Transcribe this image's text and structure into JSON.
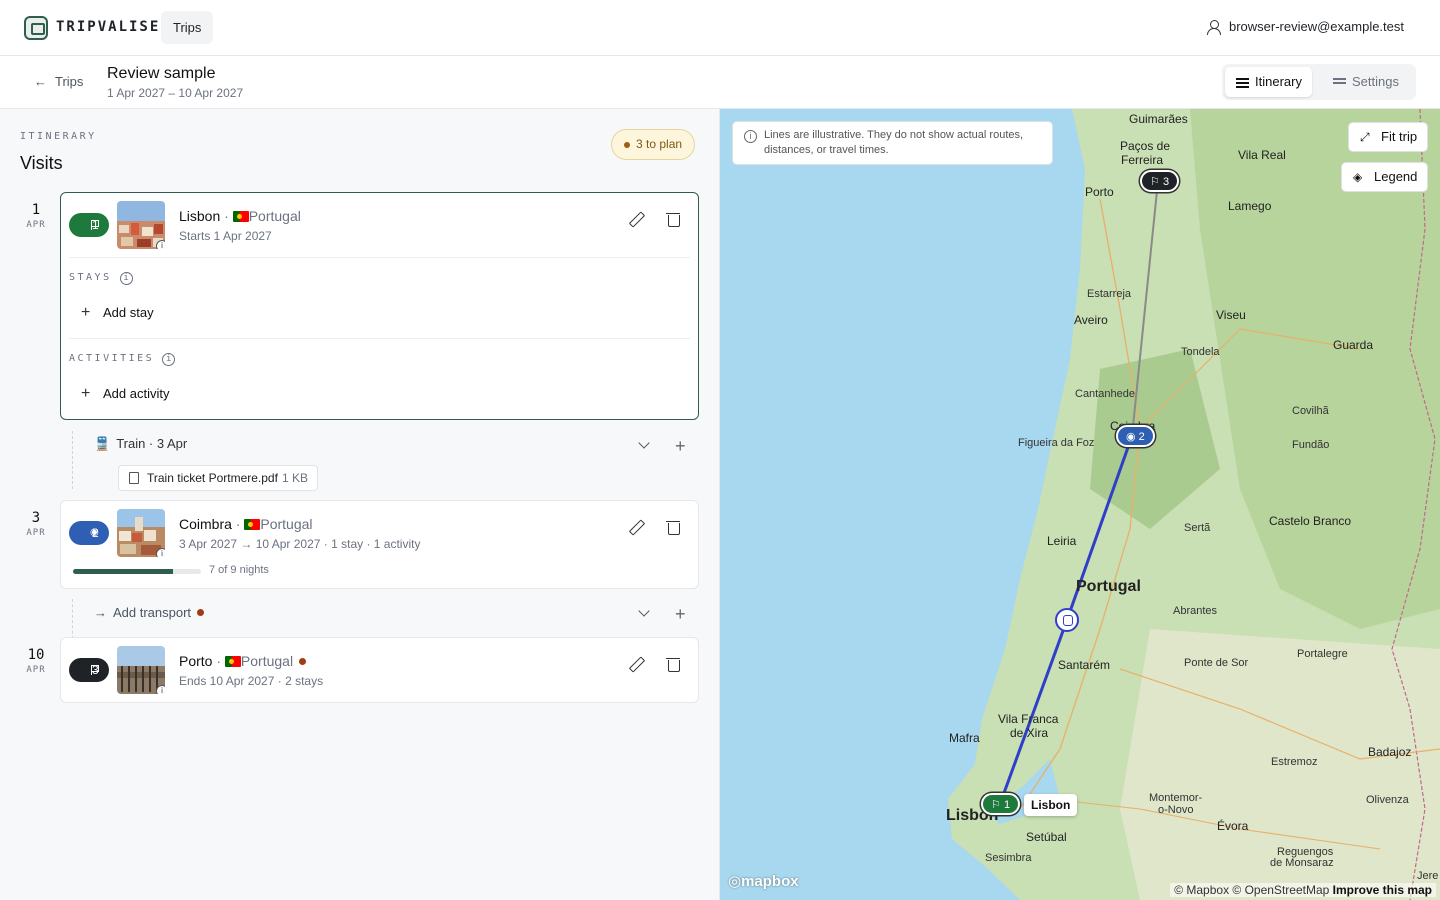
{
  "app": {
    "brand": "TRIPVALISE",
    "nav_tab": "Trips",
    "user_email": "browser-review@example.test"
  },
  "header": {
    "back_label": "Trips",
    "trip_title": "Review sample",
    "trip_dates": "1 Apr 2027 – 10 Apr 2027",
    "tabs": [
      {
        "label": "Itinerary",
        "active": true
      },
      {
        "label": "Settings",
        "active": false
      }
    ]
  },
  "itinerary": {
    "section_label": "ITINERARY",
    "title": "Visits",
    "to_plan": "3 to plan",
    "visits": [
      {
        "day": "1",
        "month": "APR",
        "badge": "1",
        "badge_color": "#1e7a3c",
        "city": "Lisbon",
        "country": "Portugal",
        "subtitle": "Starts 1 Apr 2027",
        "stays_label": "STAYS",
        "add_stay": "Add stay",
        "activities_label": "ACTIVITIES",
        "add_activity": "Add activity"
      },
      {
        "day": "3",
        "month": "APR",
        "badge": "2",
        "badge_color": "#2f5fb3",
        "city": "Coimbra",
        "country": "Portugal",
        "subtitle": "3 Apr 2027 → 10 Apr 2027 · 1 stay · 1 activity",
        "nights_label": "7 of 9 nights",
        "nights_progress": 0.78
      },
      {
        "day": "10",
        "month": "APR",
        "badge": "3",
        "badge_color": "#1f2328",
        "city": "Porto",
        "country": "Portugal",
        "subtitle": "Ends 10 Apr 2027 · 2 stays"
      }
    ],
    "transports": [
      {
        "label": "Train · 3 Apr",
        "file_name": "Train ticket Portmere.pdf",
        "file_size": "1 KB"
      },
      {
        "label": "Add transport"
      }
    ]
  },
  "map": {
    "note": "Lines are illustrative. They do not show actual routes, distances, or travel times.",
    "fit_trip": "Fit trip",
    "legend": "Legend",
    "pin_labels": [
      "1",
      "2",
      "3"
    ],
    "lisbon_label": "Lisbon",
    "cities": {
      "guimaraes": "Guimarães",
      "pacos": "Paços de",
      "ferreira": "Ferreira",
      "porto": "Porto",
      "vila_real": "Vila Real",
      "lamego": "Lamego",
      "estarreja": "Estarreja",
      "aveiro": "Aveiro",
      "viseu": "Viseu",
      "tondela": "Tondela",
      "guarda": "Guarda",
      "cantanhede": "Cantanhede",
      "coimbra": "Coimbra",
      "covilha": "Covilhã",
      "figueira": "Figueira da Foz",
      "fundao": "Fundão",
      "serta": "Sertã",
      "castelo": "Castelo Branco",
      "leiria": "Leiria",
      "portugal": "Portugal",
      "abrantes": "Abrantes",
      "santarem": "Santarém",
      "ponte": "Ponte de Sor",
      "portalegre": "Portalegre",
      "vila_franca": "Vila Franca",
      "de_xira": "de Xira",
      "mafra": "Mafra",
      "badajoz": "Badajoz",
      "estremoz": "Estremoz",
      "lisbon": "Lisbon",
      "montemor": "Montemor-",
      "o_novo": "o-Novo",
      "evora": "Évora",
      "olivenza": "Olivenza",
      "setubal": "Setúbal",
      "sesimbra": "Sesimbra",
      "reguengos": "Reguengos",
      "de_monsaraz": "de Monsaraz",
      "jere": "Jere"
    },
    "mapbox_logo": "mapbox",
    "attribution": "© Mapbox © OpenStreetMap",
    "improve": "Improve this map"
  }
}
